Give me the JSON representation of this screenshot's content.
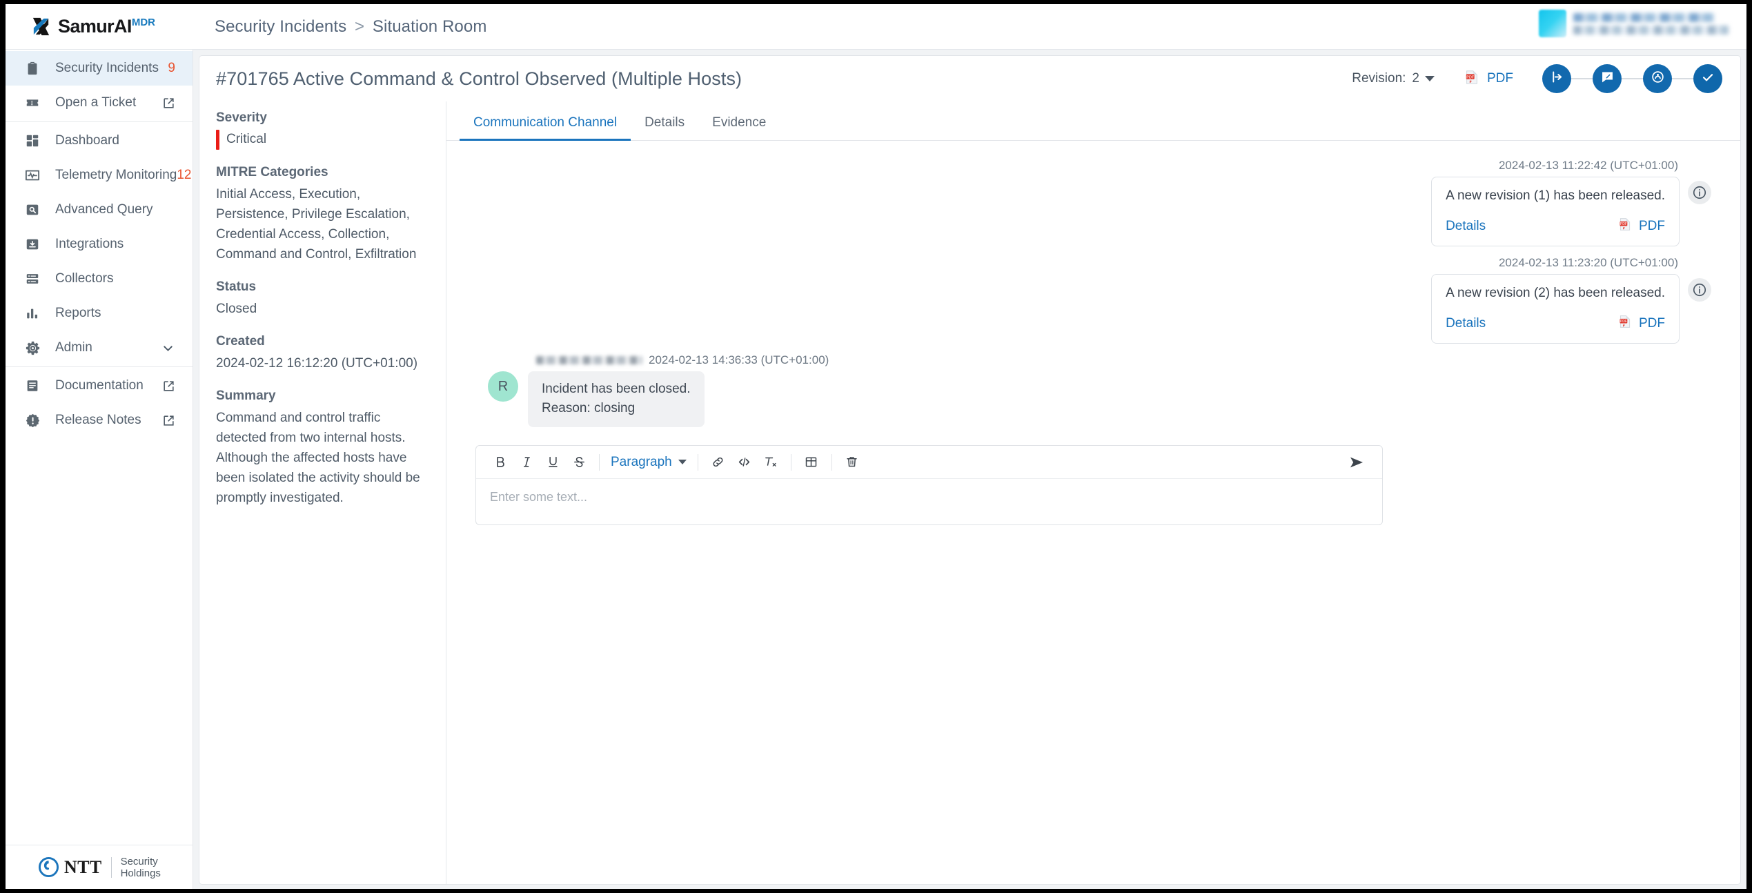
{
  "brand": {
    "name": "SamurAI",
    "suffix": "MDR",
    "logo_icon": "samurai-logo-icon"
  },
  "breadcrumb": {
    "root": "Security Incidents",
    "separator": ">",
    "current": "Situation Room"
  },
  "user": {
    "avatar_icon": "user-avatar-icon",
    "name_redacted": "",
    "org_redacted": ""
  },
  "sidebar": {
    "groups": [
      {
        "items": [
          {
            "label": "Security Incidents",
            "icon": "clipboard-icon",
            "badge": "9",
            "active": true,
            "external": false
          },
          {
            "label": "Open a Ticket",
            "icon": "ticket-icon",
            "badge": "",
            "active": false,
            "external": true
          }
        ]
      },
      {
        "items": [
          {
            "label": "Dashboard",
            "icon": "dashboard-grid-icon",
            "badge": "",
            "active": false,
            "external": false
          },
          {
            "label": "Telemetry Monitoring",
            "icon": "pulse-icon",
            "badge": "12",
            "active": false,
            "external": false
          },
          {
            "label": "Advanced Query",
            "icon": "search-box-icon",
            "badge": "",
            "active": false,
            "external": false
          },
          {
            "label": "Integrations",
            "icon": "download-box-icon",
            "badge": "",
            "active": false,
            "external": false
          },
          {
            "label": "Collectors",
            "icon": "server-icon",
            "badge": "",
            "active": false,
            "external": false
          },
          {
            "label": "Reports",
            "icon": "bar-chart-icon",
            "badge": "",
            "active": false,
            "external": false
          },
          {
            "label": "Admin",
            "icon": "gear-icon",
            "badge": "",
            "active": false,
            "external": false,
            "chevron": true
          }
        ]
      },
      {
        "items": [
          {
            "label": "Documentation",
            "icon": "document-icon",
            "badge": "",
            "active": false,
            "external": true
          },
          {
            "label": "Release Notes",
            "icon": "badge-alert-icon",
            "badge": "",
            "active": false,
            "external": true
          }
        ]
      }
    ],
    "footer": {
      "logo_icon": "ntt-logo-icon",
      "logo_text": "NTT",
      "subtitle": "Security Holdings"
    }
  },
  "header": {
    "incident_title": "#701765 Active Command & Control Observed (Multiple Hosts)",
    "revision_label": "Revision:",
    "revision_value": "2",
    "pdf_label": "PDF",
    "pdf_icon": "pdf-file-icon",
    "steps": [
      {
        "icon": "incident-opened-icon",
        "name": "step-opened",
        "active": false
      },
      {
        "icon": "analysis-icon",
        "name": "step-analysis",
        "active": false
      },
      {
        "icon": "response-icon",
        "name": "step-response",
        "active": false
      },
      {
        "icon": "check-icon",
        "name": "step-closed",
        "active": true
      }
    ]
  },
  "details": {
    "severity": {
      "label": "Severity",
      "value": "Critical",
      "color": "#ea1c16"
    },
    "mitre": {
      "label": "MITRE Categories",
      "value": "Initial Access, Execution, Persistence, Privilege Escalation, Credential Access, Collection, Command and Control, Exfiltration"
    },
    "status": {
      "label": "Status",
      "value": "Closed"
    },
    "created": {
      "label": "Created",
      "value": "2024-02-12 16:12:20 (UTC+01:00)"
    },
    "summary": {
      "label": "Summary",
      "value": "Command and control traffic detected from two internal hosts. Although the affected hosts have been isolated the activity should be promptly investigated."
    }
  },
  "tabs": [
    {
      "label": "Communication Channel",
      "active": true
    },
    {
      "label": "Details",
      "active": false
    },
    {
      "label": "Evidence",
      "active": false
    }
  ],
  "thread": {
    "system_messages": [
      {
        "timestamp": "2024-02-13 11:22:42 (UTC+01:00)",
        "text": "A new revision (1) has been released.",
        "details_label": "Details",
        "pdf_label": "PDF",
        "info_icon": "info-circle-icon"
      },
      {
        "timestamp": "2024-02-13 11:23:20 (UTC+01:00)",
        "text": "A new revision (2) has been released.",
        "details_label": "Details",
        "pdf_label": "PDF",
        "info_icon": "info-circle-icon"
      }
    ],
    "user_message": {
      "avatar_initial": "R",
      "avatar_color": "#9fe5d0",
      "author_redacted": "",
      "timestamp": "2024-02-13 14:36:33 (UTC+01:00)",
      "line1": "Incident has been closed.",
      "line2": "Reason: closing"
    }
  },
  "editor": {
    "placeholder": "Enter some text...",
    "paragraph_label": "Paragraph",
    "toolbar": [
      {
        "name": "bold-icon",
        "glyph": "B"
      },
      {
        "name": "italic-icon",
        "glyph": "I"
      },
      {
        "name": "underline-icon",
        "glyph": "U"
      },
      {
        "name": "strikethrough-icon",
        "glyph": "S"
      }
    ],
    "send_icon": "send-icon",
    "link_icon": "link-icon",
    "code_icon": "code-icon",
    "clear-format_icon": "clear-format-icon",
    "table_icon": "table-icon",
    "trash_icon": "trash-icon"
  },
  "colors": {
    "accent_blue": "#1a74bd",
    "step_blue": "#1269ae",
    "badge_red": "#e8522e",
    "severity_red": "#ea1c16",
    "sidebar_active": "#e8f1f9",
    "canvas_grey": "#f1f3f5"
  }
}
